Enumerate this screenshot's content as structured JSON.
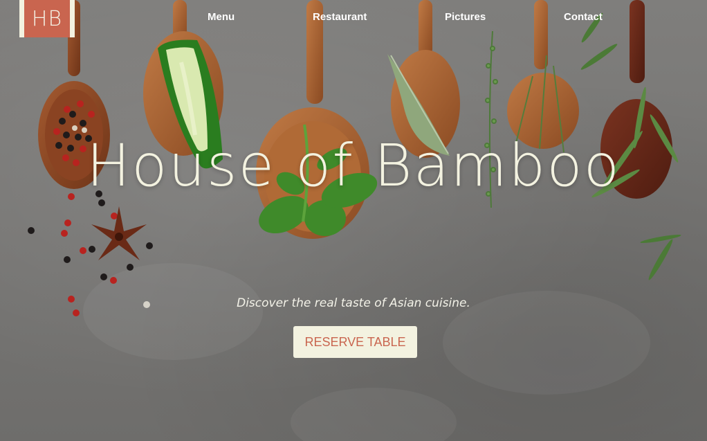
{
  "logo": {
    "text": "HB"
  },
  "nav": {
    "items": [
      {
        "label": "Menu"
      },
      {
        "label": "Restaurant"
      },
      {
        "label": "Pictures"
      },
      {
        "label": "Contact"
      }
    ]
  },
  "hero": {
    "title": "House of Bamboo",
    "subtitle": "Discover the real taste of Asian cuisine.",
    "cta_label": "RESERVE TABLE",
    "background_image": "wooden-spoons-with-spices-and-herbs"
  },
  "colors": {
    "accent": "#c9654f",
    "cream": "#f3f2e0",
    "background": "#7a7977"
  }
}
